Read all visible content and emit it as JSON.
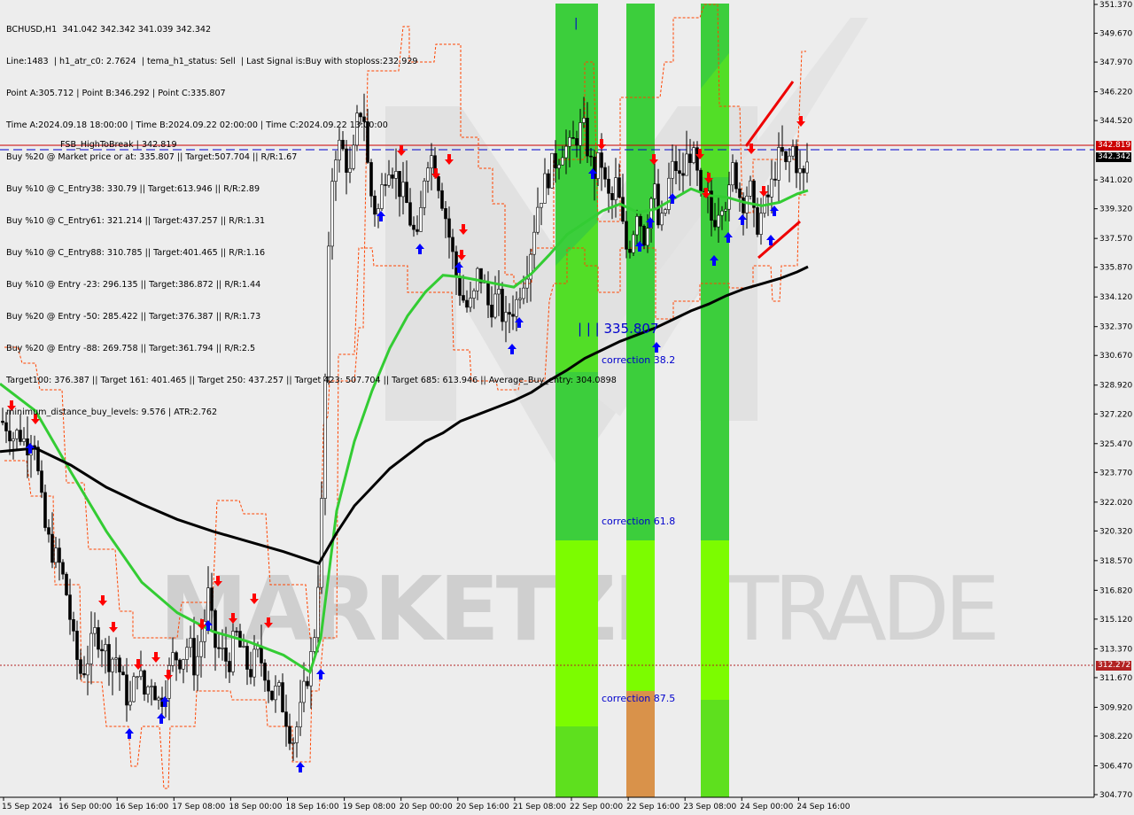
{
  "header": {
    "lines": [
      "BCHUSD,H1  341.042 342.342 341.039 342.342",
      "Line:1483  | h1_atr_c0: 2.7624  | tema_h1_status: Sell  | Last Signal is:Buy with stoploss:232.929",
      "Point A:305.712 | Point B:346.292 | Point C:335.807",
      "Time A:2024.09.18 18:00:00 | Time B:2024.09.22 02:00:00 | Time C:2024.09.22 13:00:00",
      "Buy %20 @ Market price or at: 335.807 || Target:507.704 || R/R:1.67",
      "Buy %10 @ C_Entry38: 330.79 || Target:613.946 || R/R:2.89",
      "Buy %10 @ C_Entry61: 321.214 || Target:437.257 || R/R:1.31",
      "Buy %10 @ C_Entry88: 310.785 || Target:401.465 || R/R:1.16",
      "Buy %10 @ Entry -23: 296.135 || Target:386.872 || R/R:1.44",
      "Buy %20 @ Entry -50: 285.422 || Target:376.387 || R/R:1.73",
      "Buy %20 @ Entry -88: 269.758 || Target:361.794 || R/R:2.5",
      "Target100: 376.387 || Target 161: 401.465 || Target 250: 437.257 || Target 423: 507.704 || Target 685: 613.946 || Average_Buy_entry: 304.0898",
      "minimum_distance_buy_levels: 9.576 | ATR:2.762"
    ],
    "fsb_label": "FSB_HighToBreak | 342.819"
  },
  "annotations": {
    "point_c_label": "| | |  335.807",
    "point_b_label": "|",
    "correction_38": "correction 38.2",
    "correction_61": "correction 61.8",
    "correction_87": "correction 87.5"
  },
  "watermark": {
    "text_bold": "MARKETZI",
    "text_light": "TRADE"
  },
  "price_tags": {
    "high_to_break": "342.819",
    "current": "342.342",
    "lower_level": "312.272"
  },
  "colors": {
    "background": "#ededed",
    "candle": "#000000",
    "ema_fast": "#33cc33",
    "ema_slow": "#000000",
    "envelope": "#ff4400",
    "zone_green": "#33cc33",
    "zone_lime": "#7cfc00",
    "zone_orange": "#d9924a",
    "buy_arrow": "#0000ff",
    "sell_arrow": "#ff0000",
    "red_line": "#cc0000",
    "blue_dashed": "#0000cc",
    "lower_dotted": "#b22222"
  },
  "chart_data": {
    "type": "candlestick",
    "symbol": "BCHUSD",
    "timeframe": "H1",
    "ylim": [
      304.77,
      351.37
    ],
    "y_ticks": [
      "351.370",
      "349.670",
      "347.970",
      "346.220",
      "344.520",
      "342.819",
      "342.342",
      "341.020",
      "339.320",
      "337.570",
      "335.870",
      "334.120",
      "332.370",
      "330.670",
      "328.920",
      "327.220",
      "325.470",
      "323.770",
      "322.020",
      "320.320",
      "318.570",
      "316.820",
      "315.120",
      "313.370",
      "312.272",
      "311.670",
      "309.920",
      "308.220",
      "306.470",
      "304.770"
    ],
    "x_ticks": [
      "15 Sep 2024",
      "16 Sep 00:00",
      "16 Sep 16:00",
      "17 Sep 08:00",
      "18 Sep 00:00",
      "18 Sep 16:00",
      "19 Sep 08:00",
      "20 Sep 00:00",
      "20 Sep 16:00",
      "21 Sep 08:00",
      "22 Sep 00:00",
      "22 Sep 16:00",
      "23 Sep 08:00",
      "24 Sep 00:00",
      "24 Sep 16:00"
    ],
    "levels": {
      "high_to_break": 342.819,
      "current_price": 342.342,
      "lower_level": 312.272,
      "point_c": 335.807
    },
    "close_path": [
      [
        0,
        326.8
      ],
      [
        8,
        326.6
      ],
      [
        15,
        325.9
      ],
      [
        22,
        326.1
      ],
      [
        30,
        325.4
      ],
      [
        38,
        326.3
      ],
      [
        45,
        322.5
      ],
      [
        52,
        320.1
      ],
      [
        60,
        319.0
      ],
      [
        68,
        318.2
      ],
      [
        76,
        316.4
      ],
      [
        84,
        313.3
      ],
      [
        92,
        311.8
      ],
      [
        100,
        313.0
      ],
      [
        108,
        314.4
      ],
      [
        115,
        313.7
      ],
      [
        123,
        312.8
      ],
      [
        131,
        312.9
      ],
      [
        139,
        311.2
      ],
      [
        147,
        310.0
      ],
      [
        155,
        312.4
      ],
      [
        163,
        310.7
      ],
      [
        171,
        311.6
      ],
      [
        180,
        310.1
      ],
      [
        188,
        311.4
      ],
      [
        196,
        313.0
      ],
      [
        205,
        312.8
      ],
      [
        213,
        313.8
      ],
      [
        220,
        312.2
      ],
      [
        228,
        314.1
      ],
      [
        235,
        316.5
      ],
      [
        242,
        313.6
      ],
      [
        250,
        313.1
      ],
      [
        258,
        312.5
      ],
      [
        266,
        314.3
      ],
      [
        274,
        312.9
      ],
      [
        282,
        312.0
      ],
      [
        290,
        313.1
      ],
      [
        298,
        312.4
      ],
      [
        306,
        310.6
      ],
      [
        314,
        310.9
      ],
      [
        322,
        309.6
      ],
      [
        330,
        307.9
      ],
      [
        338,
        309.3
      ],
      [
        346,
        311.6
      ],
      [
        354,
        313.6
      ],
      [
        362,
        319.9
      ],
      [
        366,
        327.4
      ],
      [
        370,
        334.9
      ],
      [
        374,
        340.8
      ],
      [
        380,
        343.2
      ],
      [
        388,
        342.6
      ],
      [
        396,
        341.1
      ],
      [
        404,
        344.8
      ],
      [
        410,
        345.5
      ],
      [
        414,
        342.3
      ],
      [
        420,
        339.7
      ],
      [
        426,
        338.9
      ],
      [
        432,
        340.8
      ],
      [
        438,
        342.2
      ],
      [
        445,
        341.6
      ],
      [
        452,
        340.4
      ],
      [
        458,
        339.8
      ],
      [
        465,
        338.2
      ],
      [
        472,
        337.1
      ],
      [
        478,
        341.1
      ],
      [
        484,
        342.7
      ],
      [
        490,
        342.1
      ],
      [
        497,
        340.5
      ],
      [
        504,
        338.6
      ],
      [
        510,
        336.8
      ],
      [
        516,
        335.1
      ],
      [
        522,
        334.1
      ],
      [
        528,
        333.4
      ],
      [
        534,
        333.8
      ],
      [
        540,
        335.7
      ],
      [
        546,
        334.9
      ],
      [
        552,
        333.4
      ],
      [
        558,
        334.0
      ],
      [
        564,
        333.8
      ],
      [
        570,
        332.4
      ],
      [
        576,
        333.4
      ],
      [
        582,
        333.6
      ],
      [
        588,
        334.9
      ],
      [
        594,
        335.7
      ],
      [
        600,
        337.3
      ],
      [
        606,
        339.4
      ],
      [
        612,
        340.4
      ],
      [
        618,
        341.2
      ],
      [
        624,
        341.9
      ],
      [
        630,
        342.4
      ],
      [
        636,
        343.1
      ],
      [
        642,
        342.7
      ],
      [
        648,
        343.3
      ],
      [
        654,
        344.0
      ],
      [
        660,
        343.9
      ],
      [
        666,
        342.0
      ],
      [
        672,
        341.4
      ],
      [
        678,
        342.4
      ],
      [
        684,
        340.3
      ],
      [
        690,
        339.5
      ],
      [
        696,
        341.0
      ],
      [
        702,
        338.4
      ],
      [
        708,
        336.7
      ],
      [
        714,
        337.9
      ],
      [
        720,
        339.7
      ],
      [
        726,
        337.4
      ],
      [
        732,
        339.1
      ],
      [
        738,
        340.7
      ],
      [
        744,
        337.9
      ],
      [
        750,
        338.9
      ],
      [
        756,
        341.3
      ],
      [
        762,
        342.0
      ],
      [
        768,
        340.8
      ],
      [
        774,
        342.1
      ],
      [
        780,
        342.8
      ],
      [
        786,
        341.5
      ],
      [
        792,
        339.3
      ],
      [
        798,
        340.1
      ],
      [
        804,
        338.4
      ],
      [
        810,
        339.4
      ],
      [
        816,
        340.1
      ],
      [
        822,
        339.7
      ],
      [
        828,
        342.0
      ],
      [
        834,
        340.2
      ],
      [
        840,
        339.8
      ],
      [
        846,
        340.8
      ],
      [
        852,
        338.2
      ],
      [
        858,
        338.8
      ],
      [
        864,
        339.6
      ],
      [
        870,
        340.4
      ],
      [
        876,
        341.9
      ],
      [
        882,
        342.6
      ],
      [
        888,
        341.5
      ],
      [
        894,
        343.1
      ],
      [
        900,
        341.8
      ],
      [
        906,
        340.9
      ],
      [
        912,
        342.3
      ]
    ],
    "ema_fast_path": [
      [
        0,
        329.0
      ],
      [
        40,
        327.4
      ],
      [
        80,
        323.8
      ],
      [
        120,
        320.3
      ],
      [
        160,
        317.3
      ],
      [
        200,
        315.5
      ],
      [
        240,
        314.4
      ],
      [
        280,
        313.8
      ],
      [
        320,
        313.0
      ],
      [
        350,
        312.0
      ],
      [
        362,
        314.0
      ],
      [
        380,
        321.5
      ],
      [
        400,
        325.6
      ],
      [
        420,
        328.6
      ],
      [
        440,
        331.1
      ],
      [
        460,
        333.0
      ],
      [
        480,
        334.4
      ],
      [
        500,
        335.4
      ],
      [
        520,
        335.3
      ],
      [
        540,
        335.1
      ],
      [
        560,
        334.9
      ],
      [
        580,
        334.7
      ],
      [
        600,
        335.5
      ],
      [
        620,
        336.6
      ],
      [
        640,
        337.8
      ],
      [
        660,
        338.5
      ],
      [
        680,
        339.2
      ],
      [
        700,
        339.6
      ],
      [
        720,
        339.1
      ],
      [
        740,
        339.3
      ],
      [
        760,
        339.9
      ],
      [
        780,
        340.5
      ],
      [
        800,
        340.1
      ],
      [
        820,
        340.0
      ],
      [
        840,
        339.7
      ],
      [
        860,
        339.5
      ],
      [
        880,
        339.7
      ],
      [
        900,
        340.2
      ],
      [
        912,
        340.4
      ]
    ],
    "ema_slow_path": [
      [
        0,
        325.0
      ],
      [
        40,
        325.2
      ],
      [
        80,
        324.2
      ],
      [
        120,
        322.9
      ],
      [
        160,
        321.9
      ],
      [
        200,
        321.0
      ],
      [
        240,
        320.3
      ],
      [
        280,
        319.7
      ],
      [
        320,
        319.1
      ],
      [
        360,
        318.4
      ],
      [
        380,
        320.2
      ],
      [
        400,
        321.8
      ],
      [
        420,
        322.9
      ],
      [
        440,
        324.0
      ],
      [
        460,
        324.8
      ],
      [
        480,
        325.6
      ],
      [
        500,
        326.1
      ],
      [
        520,
        326.8
      ],
      [
        540,
        327.2
      ],
      [
        560,
        327.6
      ],
      [
        580,
        328.0
      ],
      [
        600,
        328.5
      ],
      [
        620,
        329.2
      ],
      [
        640,
        329.8
      ],
      [
        660,
        330.5
      ],
      [
        680,
        331.0
      ],
      [
        700,
        331.5
      ],
      [
        720,
        331.9
      ],
      [
        740,
        332.3
      ],
      [
        760,
        332.8
      ],
      [
        780,
        333.3
      ],
      [
        800,
        333.7
      ],
      [
        820,
        334.2
      ],
      [
        840,
        334.6
      ],
      [
        860,
        334.9
      ],
      [
        880,
        335.2
      ],
      [
        900,
        335.6
      ],
      [
        912,
        335.9
      ]
    ]
  }
}
